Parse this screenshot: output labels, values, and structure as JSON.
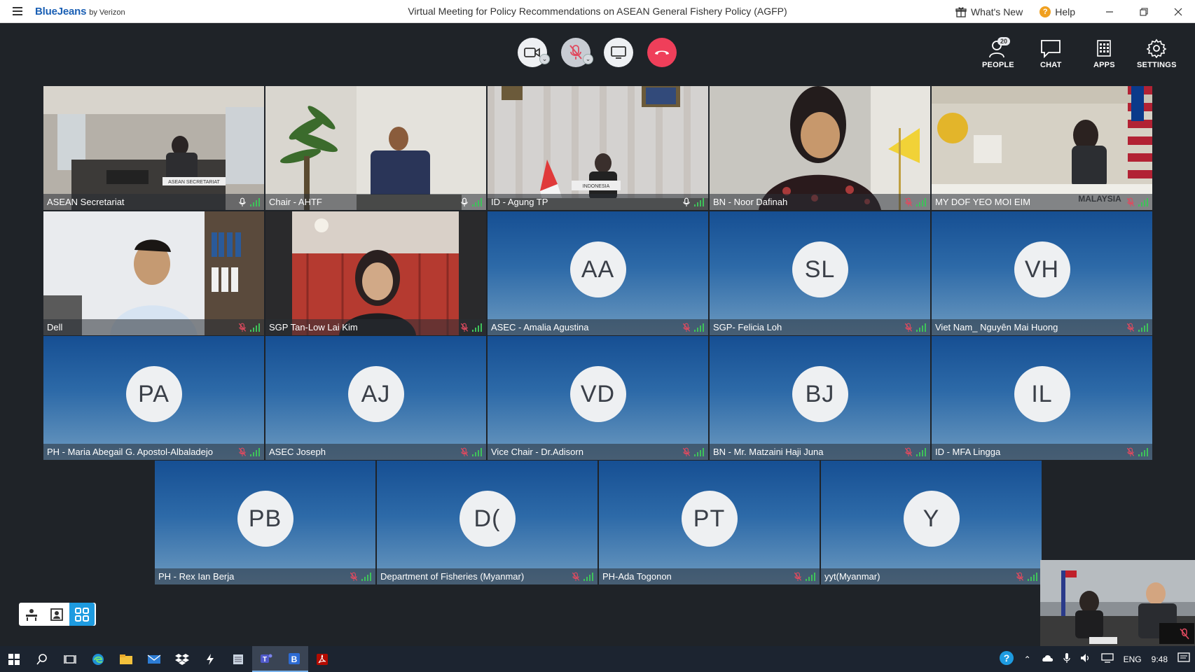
{
  "window": {
    "brand_main": "BlueJeans",
    "brand_sub": "by Verizon",
    "title": "Virtual Meeting for Policy Recommendations on ASEAN General Fishery Policy (AGFP)",
    "whats_new": "What's New",
    "help": "Help"
  },
  "toolbar": {
    "people_label": "PEOPLE",
    "people_count": "20",
    "chat_label": "CHAT",
    "apps_label": "APPS",
    "settings_label": "SETTINGS"
  },
  "tiles": [
    {
      "name": "ASEAN Secretariat",
      "initials": "",
      "muted": false
    },
    {
      "name": "Chair - AHTF",
      "initials": "",
      "muted": false
    },
    {
      "name": "ID - Agung TP",
      "initials": "",
      "muted": false
    },
    {
      "name": "BN - Noor Dafinah",
      "initials": "",
      "muted": true
    },
    {
      "name": "MY DOF YEO MOI EIM",
      "initials": "",
      "muted": true
    },
    {
      "name": "Dell",
      "initials": "",
      "muted": true
    },
    {
      "name": "SGP Tan-Low Lai Kim",
      "initials": "",
      "muted": true
    },
    {
      "name": "ASEC - Amalia Agustina",
      "initials": "AA",
      "muted": true
    },
    {
      "name": "SGP-  Felicia Loh",
      "initials": "SL",
      "muted": true
    },
    {
      "name": "Viet Nam_ Nguyên Mai Huong",
      "initials": "VH",
      "muted": true
    },
    {
      "name": "PH - Maria Abegail G. Apostol-Albaladejo",
      "initials": "PA",
      "muted": true
    },
    {
      "name": "ASEC Joseph",
      "initials": "AJ",
      "muted": true
    },
    {
      "name": "Vice Chair - Dr.Adisorn",
      "initials": "VD",
      "muted": true
    },
    {
      "name": "BN - Mr. Matzaini Haji Juna",
      "initials": "BJ",
      "muted": true
    },
    {
      "name": "ID - MFA Lingga",
      "initials": "IL",
      "muted": true
    },
    {
      "name": "PH - Rex Ian Berja",
      "initials": "PB",
      "muted": true
    },
    {
      "name": "Department of Fisheries (Myanmar)",
      "initials": "D(",
      "muted": true
    },
    {
      "name": "PH-Ada Togonon",
      "initials": "PT",
      "muted": true
    },
    {
      "name": "yyt(Myanmar)",
      "initials": "Y",
      "muted": true
    }
  ],
  "tile_labels": {
    "placard_asean": "ASEAN SECRETARIAT",
    "placard_indonesia": "INDONESIA",
    "placard_malaysia": "MALAYSIA"
  },
  "taskbar": {
    "language": "ENG",
    "time": "9:48"
  },
  "colors": {
    "accent": "#1e9be0",
    "hangup": "#ef3f5a",
    "tile_top": "#164f93",
    "tile_bottom": "#6d9ac0",
    "mute_icon": "#e04a5f",
    "signal": "#3ec25a"
  }
}
